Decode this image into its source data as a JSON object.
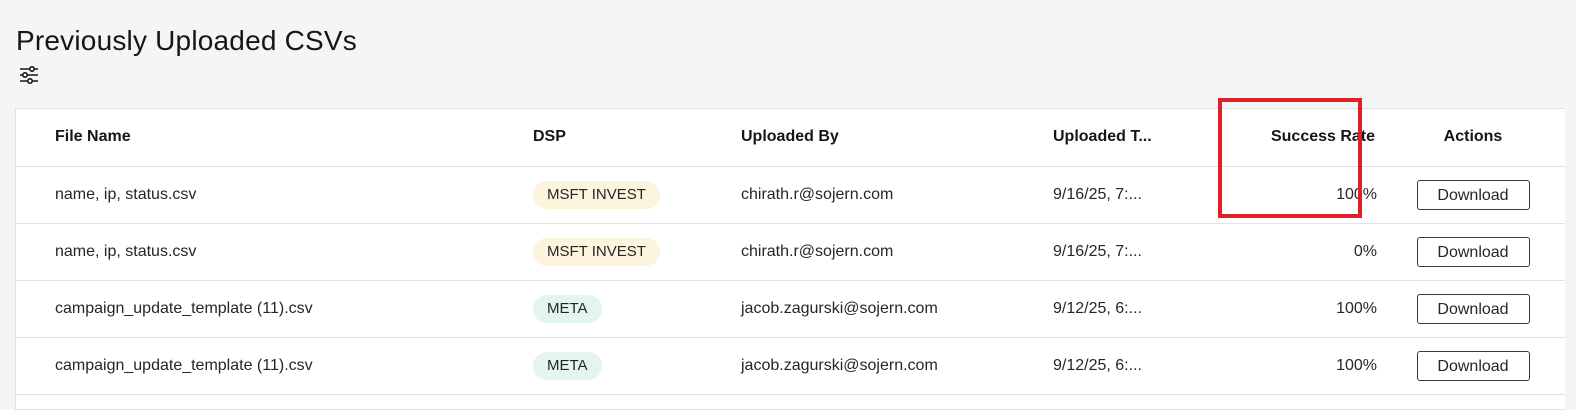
{
  "page": {
    "title": "Previously Uploaded CSVs"
  },
  "toolbar": {
    "filter_icon": "sliders-filter-icon"
  },
  "table": {
    "headers": {
      "file_name": "File Name",
      "dsp": "DSP",
      "uploaded_by": "Uploaded By",
      "uploaded_time": "Uploaded T...",
      "success_rate": "Success Rate",
      "actions": "Actions"
    },
    "rows": [
      {
        "file_name": "name, ip, status.csv",
        "dsp": "MSFT INVEST",
        "dsp_color": "#fcf4dc",
        "uploaded_by": "chirath.r@sojern.com",
        "uploaded_time": "9/16/25, 7:...",
        "success_rate": "100%",
        "action": "Download"
      },
      {
        "file_name": "name, ip, status.csv",
        "dsp": "MSFT INVEST",
        "dsp_color": "#fcf4dc",
        "uploaded_by": "chirath.r@sojern.com",
        "uploaded_time": "9/16/25, 7:...",
        "success_rate": "0%",
        "action": "Download"
      },
      {
        "file_name": "campaign_update_template (11).csv",
        "dsp": "META",
        "dsp_color": "#e3f5ee",
        "uploaded_by": "jacob.zagurski@sojern.com",
        "uploaded_time": "9/12/25, 6:...",
        "success_rate": "100%",
        "action": "Download"
      },
      {
        "file_name": "campaign_update_template (11).csv",
        "dsp": "META",
        "dsp_color": "#e3f5ee",
        "uploaded_by": "jacob.zagurski@sojern.com",
        "uploaded_time": "9/12/25, 6:...",
        "success_rate": "100%",
        "action": "Download"
      }
    ]
  },
  "annotation": {
    "highlight_color": "#e01f26",
    "highlighted_column": "Success Rate"
  }
}
